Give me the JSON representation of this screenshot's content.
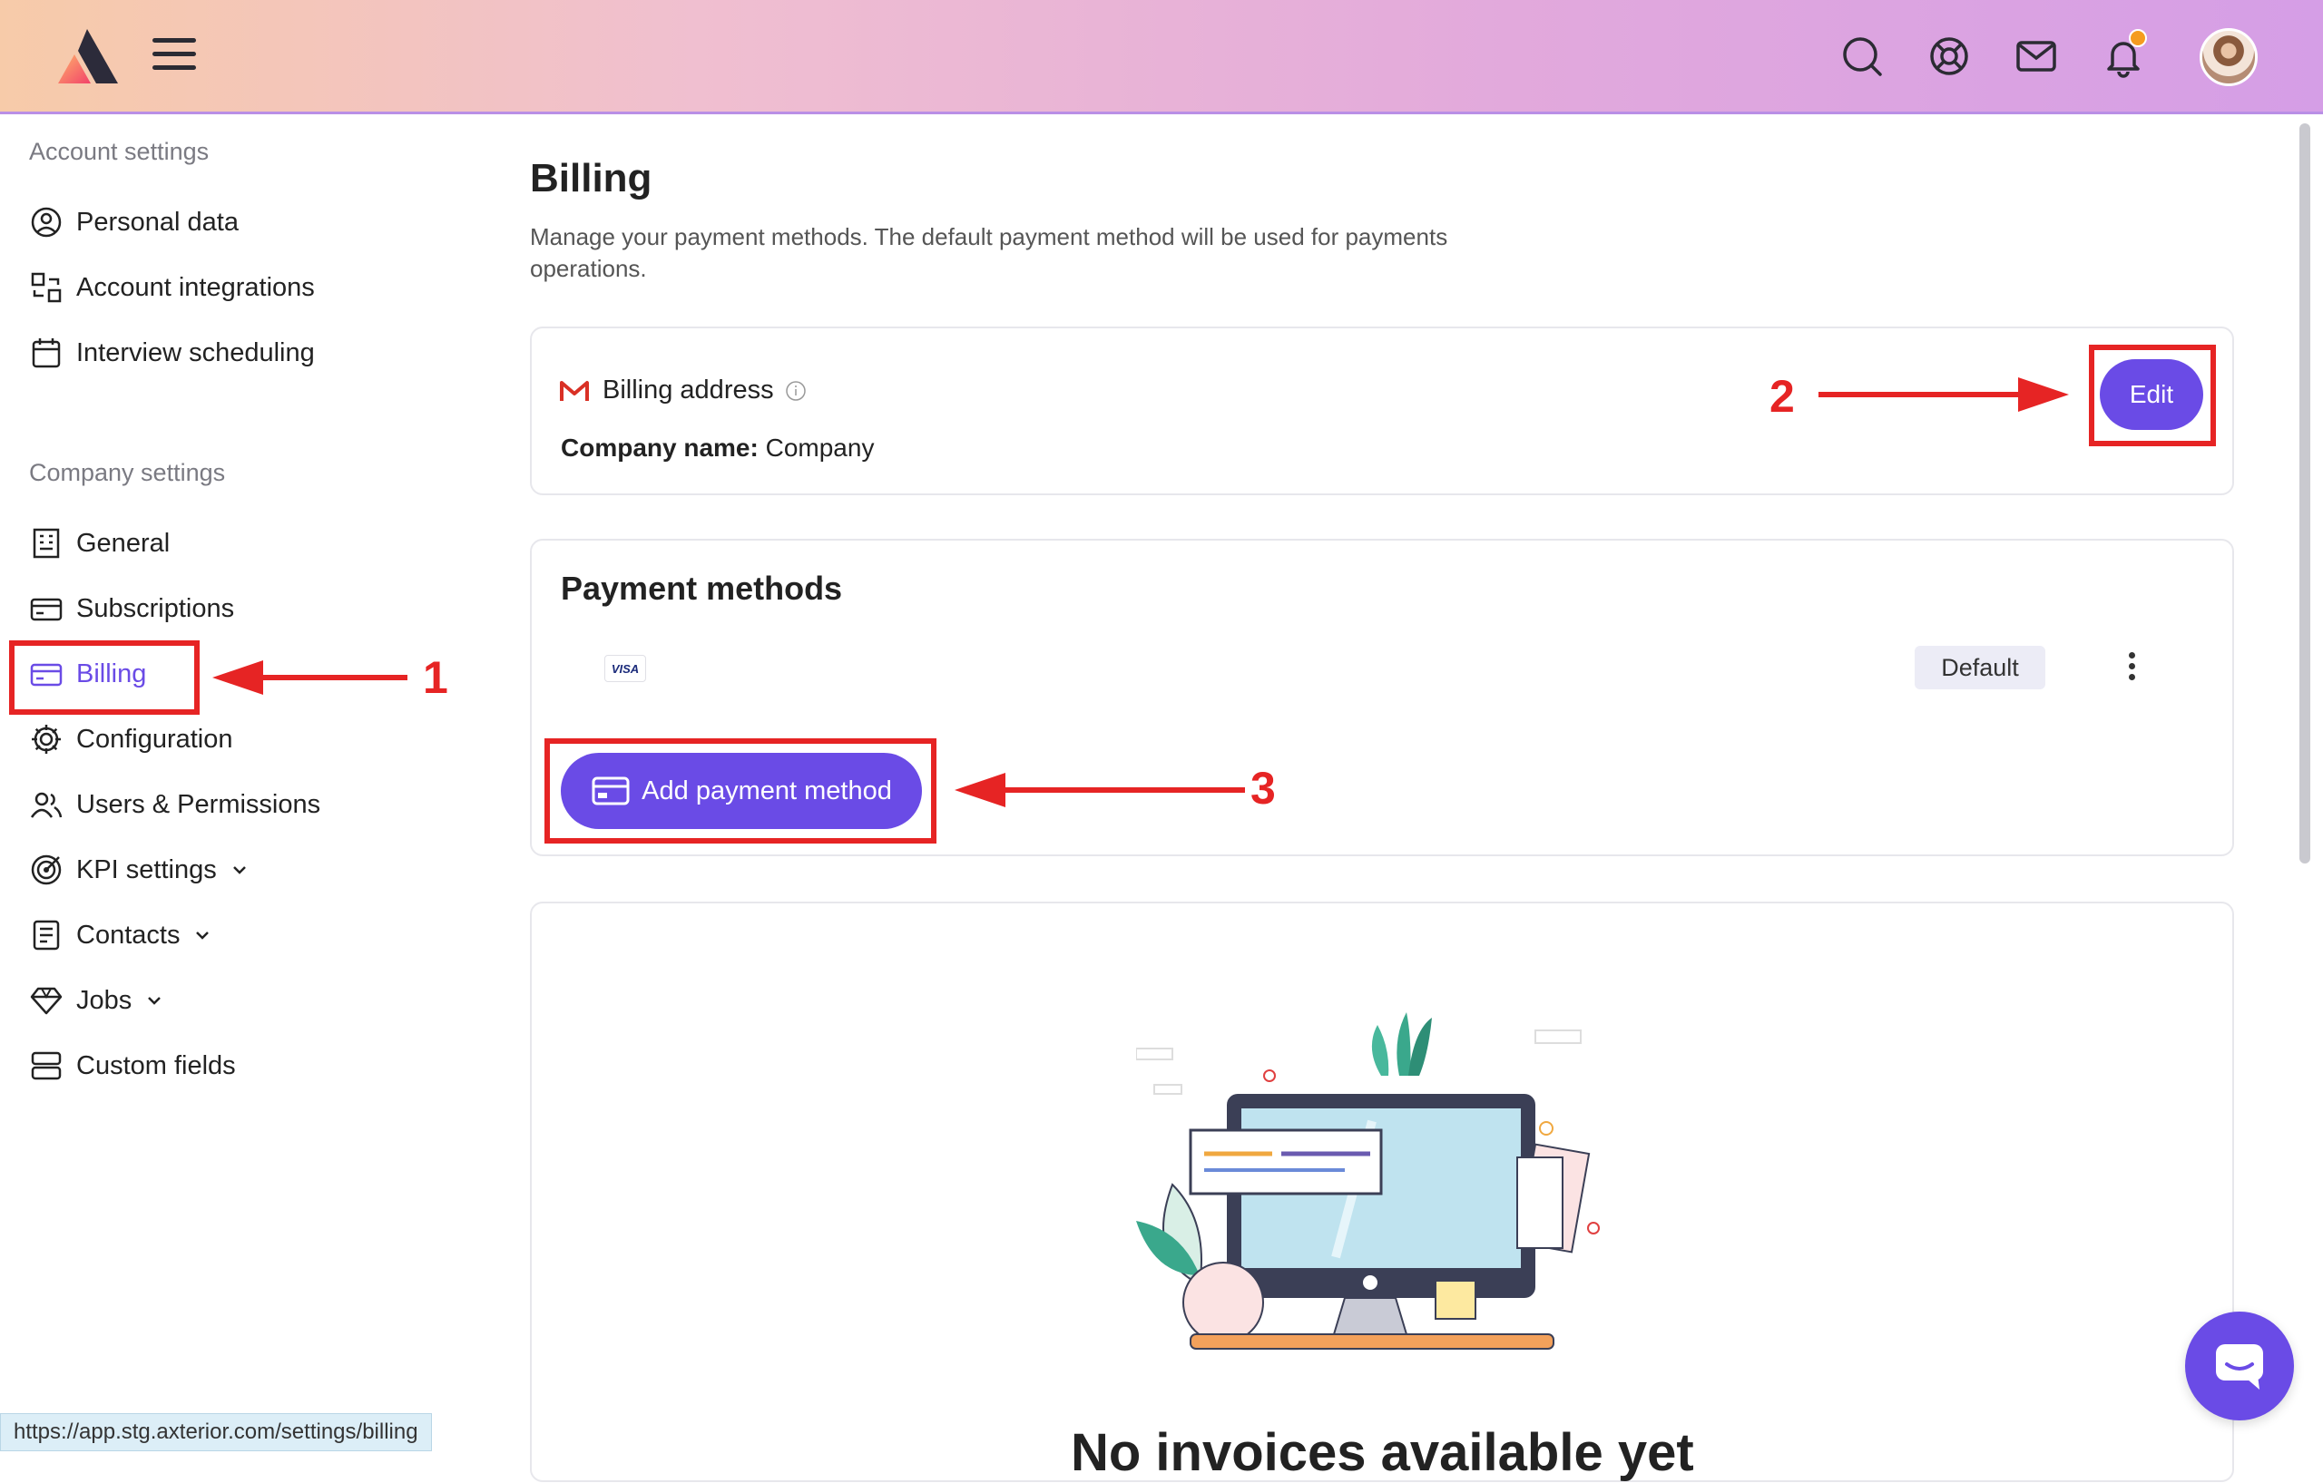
{
  "header": {
    "logo_icon": "app-logo-icon",
    "menu_icon": "hamburger-menu-icon",
    "icons": [
      "search-icon",
      "help-lifebuoy-icon",
      "mail-icon",
      "bell-icon"
    ],
    "notification_dot_color": "#f59c1f"
  },
  "sidebar": {
    "account_heading": "Account settings",
    "account_items": [
      {
        "label": "Personal data",
        "icon": "user-circle-icon"
      },
      {
        "label": "Account integrations",
        "icon": "integrations-icon"
      },
      {
        "label": "Interview scheduling",
        "icon": "calendar-icon"
      }
    ],
    "company_heading": "Company settings",
    "company_items": [
      {
        "label": "General",
        "icon": "building-icon"
      },
      {
        "label": "Subscriptions",
        "icon": "subscriptions-icon"
      },
      {
        "label": "Billing",
        "icon": "credit-card-icon",
        "active": true
      },
      {
        "label": "Configuration",
        "icon": "gear-icon"
      },
      {
        "label": "Users & Permissions",
        "icon": "users-icon"
      },
      {
        "label": "KPI settings",
        "icon": "target-icon",
        "expandable": true
      },
      {
        "label": "Contacts",
        "icon": "contacts-icon",
        "expandable": true
      },
      {
        "label": "Jobs",
        "icon": "diamond-icon",
        "expandable": true
      },
      {
        "label": "Custom fields",
        "icon": "custom-fields-icon"
      }
    ]
  },
  "main": {
    "title": "Billing",
    "description": "Manage your payment methods. The default payment method will be used for payments operations.",
    "billing_address": {
      "label": "Billing address",
      "company_label": "Company name:",
      "company_value": "Company",
      "edit_label": "Edit"
    },
    "payment_methods": {
      "title": "Payment methods",
      "card_brand": "VISA",
      "default_label": "Default",
      "add_label": "Add payment method"
    },
    "invoices": {
      "empty_text": "No invoices available yet"
    }
  },
  "annotations": {
    "callout_1": "1",
    "callout_2": "2",
    "callout_3": "3",
    "color": "#e62424"
  },
  "status_bar": {
    "url": "https://app.stg.axterior.com/settings/billing"
  },
  "colors": {
    "accent": "#6a4be6"
  }
}
